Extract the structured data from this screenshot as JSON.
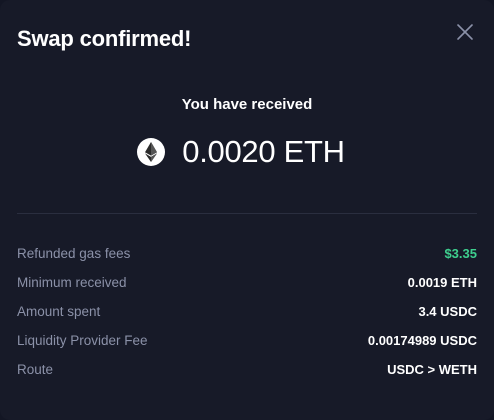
{
  "modal": {
    "title": "Swap confirmed!",
    "close_icon": "close-icon"
  },
  "received": {
    "label": "You have received",
    "token_icon": "ethereum-icon",
    "amount": "0.0020 ETH"
  },
  "details": [
    {
      "label": "Refunded gas fees",
      "value": "$3.35",
      "color": "#3ecf8e"
    },
    {
      "label": "Minimum received",
      "value": "0.0019 ETH"
    },
    {
      "label": "Amount spent",
      "value": "3.4 USDC"
    },
    {
      "label": "Liquidity Provider Fee",
      "value": "0.00174989 USDC"
    },
    {
      "label": "Route",
      "value": "USDC > WETH"
    }
  ],
  "colors": {
    "background": "#171a28",
    "accent_green": "#3ecf8e",
    "muted_text": "#8b91a8"
  }
}
